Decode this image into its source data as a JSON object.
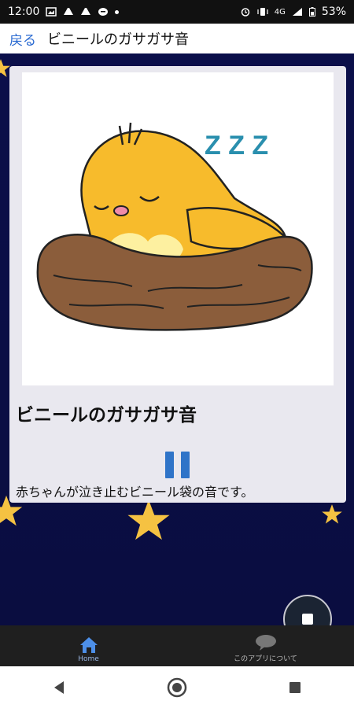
{
  "status_bar": {
    "time": "12:00",
    "network": "4G",
    "battery": "53%",
    "icons": [
      "image-icon",
      "artstation-icon",
      "artstation-icon",
      "chat-icon",
      "dot-icon",
      "alarm-icon",
      "vibrate-icon",
      "signal-icon",
      "battery-icon"
    ]
  },
  "header": {
    "back_label": "戻る",
    "title": "ビニールのガサガサ音"
  },
  "card": {
    "illustration": "sleeping-chick-in-nest",
    "snore_text": "Z Z Z",
    "title": "ビニールのガサガサ音",
    "description": "赤ちゃんが泣き止むビニール袋の音です。",
    "player_state": "pause-icon"
  },
  "fab": {
    "icon": "stop-icon"
  },
  "tabs": [
    {
      "label": "Home",
      "icon": "home-icon",
      "active": true
    },
    {
      "label": "このアプリについて",
      "icon": "chat-bubble-icon",
      "active": false
    }
  ],
  "navbar": {
    "buttons": [
      "back-triangle-icon",
      "home-circle-icon",
      "recents-square-icon"
    ]
  },
  "colors": {
    "accent": "#2f74c8",
    "background": "#0b0f4a",
    "card": "#e9e8ef",
    "star": "#f5c242",
    "tabbar": "#1f1f1f"
  }
}
